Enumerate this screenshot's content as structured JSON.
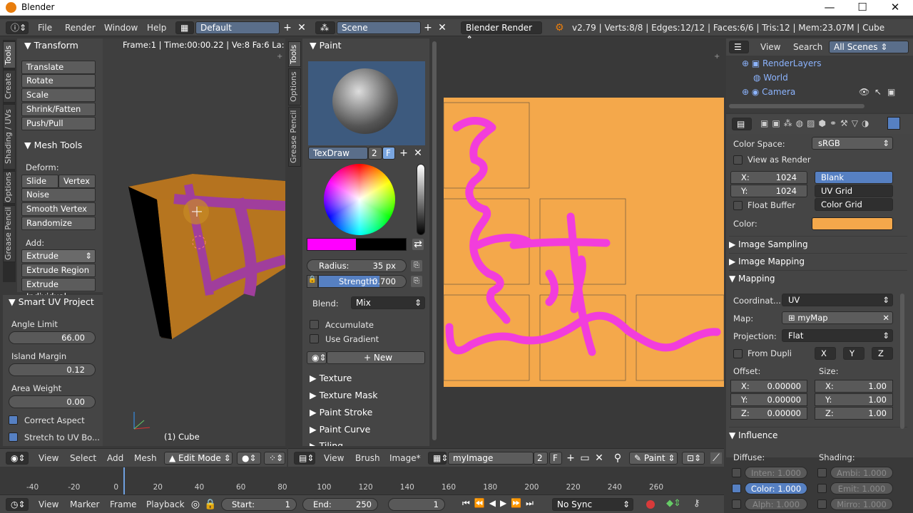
{
  "window": {
    "title": "Blender",
    "minimize": "—",
    "maximize": "☐",
    "close": "✕"
  },
  "info_header": {
    "menus": [
      "File",
      "Render",
      "Window",
      "Help"
    ],
    "layout": "Default",
    "scene": "Scene",
    "engine": "Blender Render",
    "stats": "v2.79 | Verts:8/8 | Edges:12/12 | Faces:6/6 | Tris:12 | Mem:23.07M | Cube"
  },
  "tool_tabs": [
    "Tools",
    "Create",
    "Shading / UVs",
    "Options",
    "Grease Pencil"
  ],
  "transform": {
    "title": "Transform",
    "buttons": [
      "Translate",
      "Rotate",
      "Scale",
      "Shrink/Fatten",
      "Push/Pull"
    ]
  },
  "mesh_tools": {
    "title": "Mesh Tools",
    "deform_label": "Deform:",
    "slide_edge": "Slide Ed",
    "vertex": "Vertex",
    "buttons": [
      "Noise",
      "Smooth Vertex",
      "Randomize"
    ],
    "add_label": "Add:",
    "extrude": "Extrude",
    "more": [
      "Extrude Region",
      "Extrude Individual"
    ]
  },
  "smart_uv": {
    "title": "Smart UV Project",
    "angle_label": "Angle Limit",
    "angle": "66.00",
    "island_label": "Island Margin",
    "island": "0.12",
    "area_label": "Area Weight",
    "area": "0.00",
    "correct_aspect": "Correct Aspect",
    "stretch": "Stretch to UV Bo..."
  },
  "viewport": {
    "info": "Frame:1 | Time:00:00.22 | Ve:8 Fa:6 La:1 | M",
    "object": "(1) Cube"
  },
  "paint_tabs": [
    "Tools",
    "Options",
    "Grease Pencil"
  ],
  "paint": {
    "title": "Paint",
    "brush": "TexDraw",
    "users": "2",
    "fake": "F",
    "radius_label": "Radius:",
    "radius": "35 px",
    "strength_label": "Strength:",
    "strength": "0.700",
    "blend_label": "Blend:",
    "blend": "Mix",
    "accumulate": "Accumulate",
    "use_gradient": "Use Gradient",
    "new": "New",
    "panels": [
      "Texture",
      "Texture Mask",
      "Paint Stroke",
      "Paint Curve",
      "Tiling"
    ],
    "color": "#ff00ff",
    "strength_fraction": 0.7
  },
  "outliner": {
    "menus": [
      "View",
      "Search"
    ],
    "filter": "All Scenes",
    "items": [
      "RenderLayers",
      "World",
      "Camera"
    ]
  },
  "props": {
    "color_space_label": "Color Space:",
    "color_space": "sRGB",
    "view_as_render": "View as Render",
    "x_label": "X:",
    "x": "1024",
    "y_label": "Y:",
    "y": "1024",
    "generated": [
      "Blank",
      "UV Grid",
      "Color Grid"
    ],
    "float_buffer": "Float Buffer",
    "color_label": "Color:",
    "color": "#f4a84b",
    "sections": [
      "Image Sampling",
      "Image Mapping",
      "Mapping"
    ],
    "coord_label": "Coordinat...",
    "coord": "UV",
    "map_label": "Map:",
    "map": "myMap",
    "proj_label": "Projection:",
    "proj": "Flat",
    "from_dupli": "From Dupli",
    "axes": [
      "X",
      "Y",
      "Z"
    ],
    "offset_label": "Offset:",
    "size_label": "Size:",
    "offset": [
      {
        "k": "X:",
        "v": "0.00000"
      },
      {
        "k": "Y:",
        "v": "0.00000"
      },
      {
        "k": "Z:",
        "v": "0.00000"
      }
    ],
    "size": [
      {
        "k": "X:",
        "v": "1.00"
      },
      {
        "k": "Y:",
        "v": "1.00"
      },
      {
        "k": "Z:",
        "v": "1.00"
      }
    ],
    "influence": "Influence",
    "diffuse_label": "Diffuse:",
    "shading_label": "Shading:",
    "diffuse": [
      "Inten: 1.000",
      "Color: 1.000",
      "Alph: 1.000"
    ],
    "shading": [
      "Ambi: 1.000",
      "Emit: 1.000",
      "Mirro: 1.000"
    ]
  },
  "view3d_header": {
    "menus": [
      "View",
      "Select",
      "Add",
      "Mesh"
    ],
    "mode": "Edit Mode"
  },
  "image_header": {
    "menus": [
      "View",
      "Brush",
      "Image*"
    ],
    "image": "myImage",
    "users": "2",
    "fake": "F",
    "mode": "Paint"
  },
  "timeline": {
    "ticks": [
      "-40",
      "-20",
      "0",
      "20",
      "40",
      "60",
      "80",
      "100",
      "120",
      "140",
      "160",
      "180",
      "200",
      "220",
      "240",
      "260"
    ],
    "menus": [
      "View",
      "Marker",
      "Frame",
      "Playback"
    ],
    "start_label": "Start:",
    "start": "1",
    "end_label": "End:",
    "end": "250",
    "current": "1",
    "sync": "No Sync"
  },
  "axis": {
    "x": "x",
    "y": "y",
    "z": "z"
  }
}
